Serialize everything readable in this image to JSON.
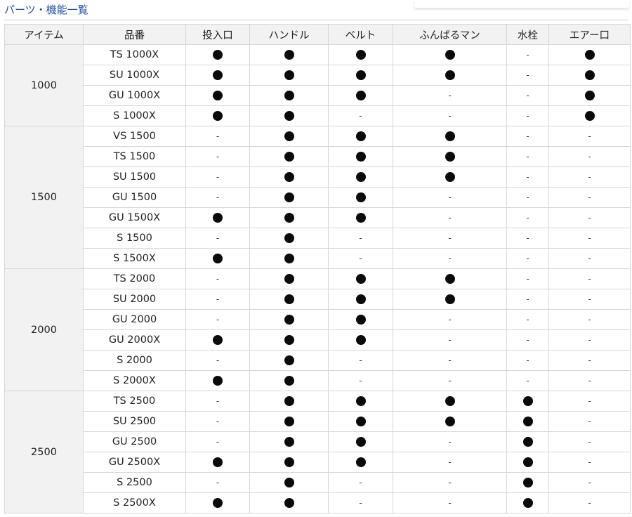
{
  "section_title": "パーツ・機能一覧",
  "table": {
    "headers": [
      "アイテム",
      "品番",
      "投入口",
      "ハンドル",
      "ベルト",
      "ふんばるマン",
      "水栓",
      "エアー口"
    ],
    "marks": {
      "yes": "●",
      "no": "-"
    },
    "groups": [
      {
        "item": "1000",
        "rows": [
          {
            "model": "TS 1000X",
            "values": [
              "yes",
              "yes",
              "yes",
              "yes",
              "no",
              "yes"
            ]
          },
          {
            "model": "SU 1000X",
            "values": [
              "yes",
              "yes",
              "yes",
              "yes",
              "no",
              "yes"
            ]
          },
          {
            "model": "GU 1000X",
            "values": [
              "yes",
              "yes",
              "yes",
              "no",
              "no",
              "yes"
            ]
          },
          {
            "model": "S 1000X",
            "values": [
              "yes",
              "yes",
              "no",
              "no",
              "no",
              "yes"
            ]
          }
        ]
      },
      {
        "item": "1500",
        "rows": [
          {
            "model": "VS 1500",
            "values": [
              "no",
              "yes",
              "yes",
              "yes",
              "no",
              "no"
            ]
          },
          {
            "model": "TS 1500",
            "values": [
              "no",
              "yes",
              "yes",
              "yes",
              "no",
              "no"
            ]
          },
          {
            "model": "SU 1500",
            "values": [
              "no",
              "yes",
              "yes",
              "yes",
              "no",
              "no"
            ]
          },
          {
            "model": "GU 1500",
            "values": [
              "no",
              "yes",
              "yes",
              "no",
              "no",
              "no"
            ]
          },
          {
            "model": "GU 1500X",
            "values": [
              "yes",
              "yes",
              "yes",
              "no",
              "no",
              "no"
            ]
          },
          {
            "model": "S 1500",
            "values": [
              "no",
              "yes",
              "no",
              "no",
              "no",
              "no"
            ]
          },
          {
            "model": "S 1500X",
            "values": [
              "yes",
              "yes",
              "no",
              "no",
              "no",
              "no"
            ]
          }
        ]
      },
      {
        "item": "2000",
        "rows": [
          {
            "model": "TS 2000",
            "values": [
              "no",
              "yes",
              "yes",
              "yes",
              "no",
              "no"
            ]
          },
          {
            "model": "SU 2000",
            "values": [
              "no",
              "yes",
              "yes",
              "yes",
              "no",
              "no"
            ]
          },
          {
            "model": "GU 2000",
            "values": [
              "no",
              "yes",
              "yes",
              "no",
              "no",
              "no"
            ]
          },
          {
            "model": "GU 2000X",
            "values": [
              "yes",
              "yes",
              "yes",
              "no",
              "no",
              "no"
            ]
          },
          {
            "model": "S 2000",
            "values": [
              "no",
              "yes",
              "no",
              "no",
              "no",
              "no"
            ]
          },
          {
            "model": "S 2000X",
            "values": [
              "yes",
              "yes",
              "no",
              "no",
              "no",
              "no"
            ]
          }
        ]
      },
      {
        "item": "2500",
        "rows": [
          {
            "model": "TS 2500",
            "values": [
              "no",
              "yes",
              "yes",
              "yes",
              "yes",
              "no"
            ]
          },
          {
            "model": "SU 2500",
            "values": [
              "no",
              "yes",
              "yes",
              "yes",
              "yes",
              "no"
            ]
          },
          {
            "model": "GU 2500",
            "values": [
              "no",
              "yes",
              "yes",
              "no",
              "yes",
              "no"
            ]
          },
          {
            "model": "GU 2500X",
            "values": [
              "yes",
              "yes",
              "yes",
              "no",
              "yes",
              "no"
            ]
          },
          {
            "model": "S 2500",
            "values": [
              "no",
              "yes",
              "no",
              "no",
              "yes",
              "no"
            ]
          },
          {
            "model": "S 2500X",
            "values": [
              "yes",
              "yes",
              "no",
              "no",
              "yes",
              "no"
            ]
          }
        ]
      }
    ]
  }
}
